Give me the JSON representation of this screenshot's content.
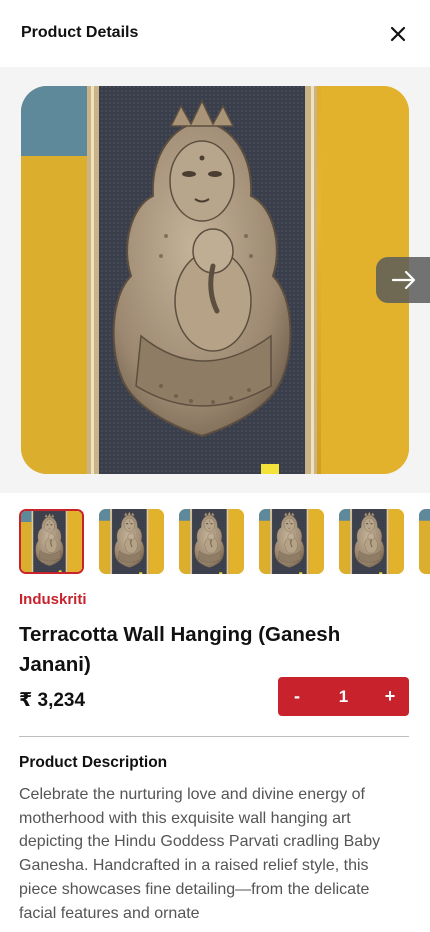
{
  "header": {
    "title": "Product Details",
    "close_icon": "close-icon"
  },
  "gallery": {
    "hero_alt": "Terracotta wall hanging of Goddess Parvati with Baby Ganesha",
    "next_icon": "arrow-right-icon",
    "thumbnail_count": 6,
    "selected_index": 0
  },
  "product": {
    "brand": "Induskriti",
    "title": "Terracotta Wall Hanging (Ganesh Janani)",
    "price": "₹ 3,234"
  },
  "quantity": {
    "minus": "-",
    "value": "1",
    "plus": "+"
  },
  "description": {
    "title": "Product Description",
    "text": "Celebrate the nurturing love and divine energy of motherhood with this exquisite wall hanging art depicting the Hindu Goddess Parvati cradling Baby Ganesha. Handcrafted in a raised relief style, this piece showcases fine detailing—from the delicate facial features and ornate"
  },
  "colors": {
    "accent": "#c8232c",
    "frame_bg": "#3a3e4a",
    "backdrop_yellow": "#e8b62a",
    "terracotta": "#a8947a"
  }
}
